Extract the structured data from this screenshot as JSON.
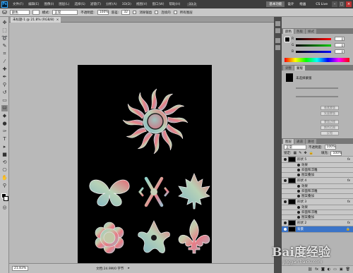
{
  "app": {
    "logo": "Ps",
    "menu": [
      "文件(F)",
      "编辑(E)",
      "图像(I)",
      "图层(L)",
      "选择(S)",
      "滤镜(T)",
      "分析(A)",
      "3D(D)",
      "视图(V)",
      "窗口(W)",
      "帮助(H)"
    ],
    "zoom_select": "33.3",
    "workspace_buttons": [
      "基本功能",
      "设计",
      "绘画"
    ],
    "live_label": "CS Live"
  },
  "options": {
    "tool_preset": "颜色",
    "mode_label": "模式:",
    "mode_value": "正常",
    "opacity_label": "不透明度:",
    "opacity_value": "100%",
    "tolerance_label": "容差:",
    "tolerance_value": "32",
    "antialias": "消除锯齿",
    "contiguous": "连续的",
    "all_layers": "所有图层"
  },
  "document": {
    "tab_title": "未标题-1 @ 21.8% (RGB/8)",
    "tab_close": "×"
  },
  "status": {
    "zoom": "21.83%",
    "doc_info": "文档:24.9M/0 字节"
  },
  "color_panel": {
    "tabs": [
      "颜色",
      "色板",
      "样式"
    ],
    "sliders": [
      {
        "label": "R",
        "value": "0",
        "color": "#e00000"
      },
      {
        "label": "G",
        "value": "0",
        "color": "#00b000"
      },
      {
        "label": "B",
        "value": "0",
        "color": "#0000e0"
      }
    ]
  },
  "adjust_panel": {
    "tabs": [
      "调整",
      "蒙版"
    ],
    "title": "未选择蒙版",
    "buttons": [
      "像素蒙版",
      "矢量蒙版",
      "蒙版边缘",
      "颜色范围",
      "反相"
    ]
  },
  "layers_panel": {
    "tabs": [
      "图层",
      "通道",
      "路径"
    ],
    "blend_mode": "正常",
    "opacity_label": "不透明度:",
    "opacity_value": "100%",
    "lock_label": "锁定:",
    "fill_label": "填充:",
    "fill_value": "100%",
    "layers": [
      {
        "name": "形状 5",
        "kind": "layer"
      },
      {
        "name": "效果",
        "kind": "sub"
      },
      {
        "name": "斜面和浮雕",
        "kind": "sub"
      },
      {
        "name": "图案叠加",
        "kind": "sub"
      },
      {
        "name": "形状 4",
        "kind": "layer"
      },
      {
        "name": "效果",
        "kind": "sub"
      },
      {
        "name": "斜面和浮雕",
        "kind": "sub"
      },
      {
        "name": "图案叠加",
        "kind": "sub"
      },
      {
        "name": "形状 3",
        "kind": "layer"
      },
      {
        "name": "效果",
        "kind": "sub"
      },
      {
        "name": "斜面和浮雕",
        "kind": "sub"
      },
      {
        "name": "图案叠加",
        "kind": "sub"
      },
      {
        "name": "形状 2",
        "kind": "layer"
      },
      {
        "name": "背景",
        "kind": "layer"
      }
    ],
    "fx_label": "fx"
  },
  "watermark": {
    "main": "Bai度经验",
    "sub": "jingyan.baidu.com"
  },
  "canvas_shapes": [
    "sun",
    "butterfly",
    "snowflake",
    "maple-leaf",
    "flower",
    "star-flower",
    "fleur-de-lis"
  ]
}
